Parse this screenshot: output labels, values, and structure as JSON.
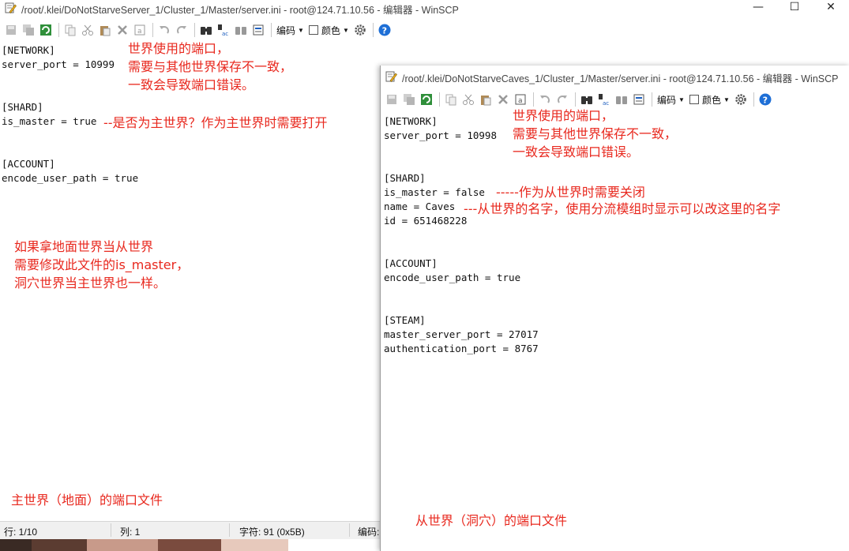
{
  "window_main": {
    "title": "/root/.klei/DoNotStarveServer_1/Cluster_1/Master/server.ini - root@124.71.10.56 - 编辑器 - WinSCP",
    "controls": {
      "minimize": "—",
      "maximize": "☐",
      "close": "✕"
    },
    "toolbar": {
      "encoding_label": "编码",
      "color_label": "颜色"
    },
    "lines": [
      "[NETWORK]",
      "server_port = 10999",
      "",
      "",
      "[SHARD]",
      "is_master = true",
      "",
      "",
      "[ACCOUNT]",
      "encode_user_path = true"
    ],
    "status": {
      "line": "行: 1/10",
      "column": "列: 1",
      "char": "字符: 91 (0x5B)",
      "encoding": "编码:"
    }
  },
  "window_caves": {
    "title": "/root/.klei/DoNotStarveCaves_1/Cluster_1/Master/server.ini - root@124.71.10.56 - 编辑器 - WinSCP",
    "toolbar": {
      "encoding_label": "编码",
      "color_label": "颜色"
    },
    "lines": [
      "[NETWORK]",
      "server_port = 10998",
      "",
      "",
      "[SHARD]",
      "is_master = false",
      "name = Caves",
      "id = 651468228",
      "",
      "",
      "[ACCOUNT]",
      "encode_user_path = true",
      "",
      "",
      "[STEAM]",
      "master_server_port = 27017",
      "authentication_port = 8767"
    ]
  },
  "annotations": {
    "main_port_note": [
      "世界使用的端口，",
      "需要与其他世界保存不一致，",
      "一致会导致端口错误。"
    ],
    "main_is_master_note": "--是否为主世界？作为主世界时需要打开",
    "main_tip": [
      "如果拿地面世界当从世界",
      "需要修改此文件的is_master，",
      "洞穴世界当主世界也一样。"
    ],
    "main_caption": "主世界（地面）的端口文件",
    "caves_port_note": [
      "世界使用的端口，",
      "需要与其他世界保存不一致，",
      "一致会导致端口错误。"
    ],
    "caves_is_master_note": "-----作为从世界时需要关闭",
    "caves_name_note": "---从世界的名字，使用分流模组时显示可以改这里的名字",
    "caves_caption": "从世界（洞穴）的端口文件"
  },
  "colors": {
    "annotation": "#e8281e",
    "help_icon": "#1e6fd6"
  }
}
